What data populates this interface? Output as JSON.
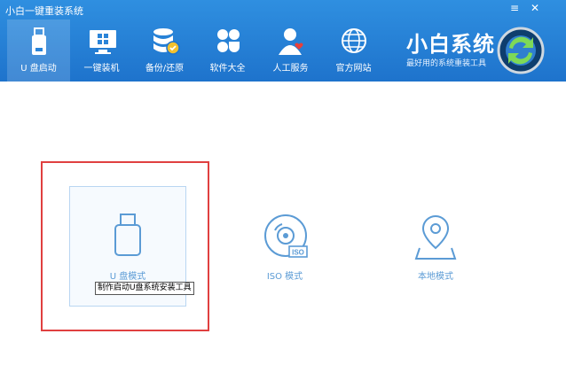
{
  "window": {
    "title": "小白一键重装系统",
    "menu_glyph": "≡",
    "close_glyph": "✕"
  },
  "nav": {
    "items": [
      {
        "label": "U 盘启动",
        "icon": "usb-drive-icon",
        "active": true
      },
      {
        "label": "一键装机",
        "icon": "monitor-windows-icon"
      },
      {
        "label": "备份/还原",
        "icon": "database-icon"
      },
      {
        "label": "软件大全",
        "icon": "app-grid-icon"
      },
      {
        "label": "人工服务",
        "icon": "support-person-icon"
      },
      {
        "label": "官方网站",
        "icon": "globe-icon"
      }
    ]
  },
  "brand": {
    "name": "小白系统",
    "tagline": "最好用的系统重装工具",
    "logo_icon": "refresh-globe-logo-icon"
  },
  "modes": [
    {
      "label": "U 盘模式",
      "icon": "usb-drive-icon",
      "selected": true
    },
    {
      "label": "ISO 模式",
      "icon": "iso-disc-icon",
      "badge": "ISO"
    },
    {
      "label": "本地模式",
      "icon": "map-pin-icon"
    }
  ],
  "tooltip": {
    "text": "制作启动U盘系统安装工具"
  },
  "colors": {
    "header": "#1e73cc",
    "accent": "#5b9bd5",
    "highlight_border": "#e04040"
  }
}
